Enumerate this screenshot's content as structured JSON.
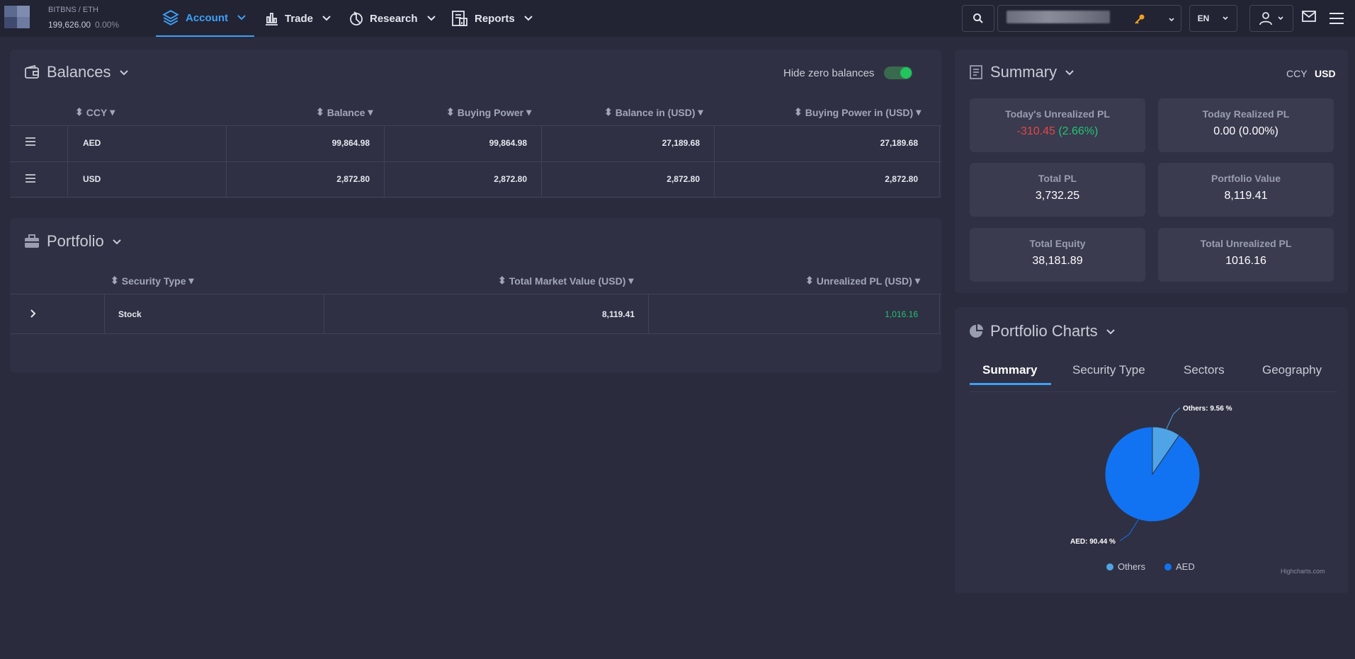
{
  "header": {
    "ticker_name": "BITBNS / ETH",
    "ticker_value": "199,626.00",
    "ticker_change": "0.00%",
    "nav": [
      "Account",
      "Trade",
      "Research",
      "Reports"
    ],
    "lang": "EN"
  },
  "balances": {
    "title": "Balances",
    "hide_zero_label": "Hide zero balances",
    "hide_zero_on": true,
    "columns": [
      "CCY",
      "Balance",
      "Buying Power",
      "Balance in (USD)",
      "Buying Power in (USD)"
    ],
    "rows": [
      [
        "AED",
        "99,864.98",
        "99,864.98",
        "27,189.68",
        "27,189.68"
      ],
      [
        "USD",
        "2,872.80",
        "2,872.80",
        "2,872.80",
        "2,872.80"
      ]
    ]
  },
  "portfolio": {
    "title": "Portfolio",
    "columns": [
      "Security Type",
      "Total Market Value (USD)",
      "Unrealized PL (USD)"
    ],
    "rows": [
      [
        "Stock",
        "8,119.41",
        "1,016.16"
      ]
    ]
  },
  "summary": {
    "title": "Summary",
    "ccy_label": "CCY",
    "ccy_value": "USD",
    "tiles": {
      "todays_unrealized_label": "Today's Unrealized PL",
      "todays_unrealized_value": "-310.45",
      "todays_unrealized_pct": "(2.66%)",
      "today_realized_label": "Today Realized PL",
      "today_realized_value": "0.00 (0.00%)",
      "total_pl_label": "Total PL",
      "total_pl_value": "3,732.25",
      "portfolio_value_label": "Portfolio Value",
      "portfolio_value_value": "8,119.41",
      "total_equity_label": "Total Equity",
      "total_equity_value": "38,181.89",
      "total_unrealized_label": "Total Unrealized PL",
      "total_unrealized_value": "1016.16"
    }
  },
  "charts": {
    "title": "Portfolio Charts",
    "tabs": [
      "Summary",
      "Security Type",
      "Sectors",
      "Geography"
    ],
    "credit": "Highcharts.com",
    "colors": {
      "Others": "#4ea4e6",
      "AED": "#1173f2"
    }
  },
  "chart_data": {
    "type": "pie",
    "categories": [
      "Others",
      "AED"
    ],
    "values": [
      9.56,
      90.44
    ],
    "data_labels": [
      "Others: 9.56 %",
      "AED: 90.44 %"
    ],
    "legend": [
      "Others",
      "AED"
    ],
    "legend_position": "bottom"
  }
}
